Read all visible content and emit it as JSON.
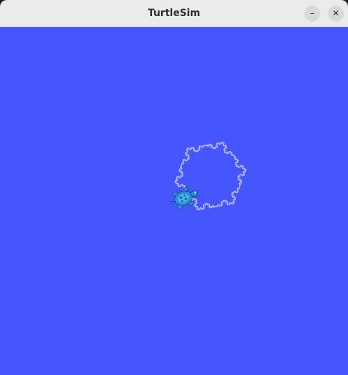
{
  "window": {
    "title": "TurtleSim"
  },
  "titlebar": {
    "minimize_glyph": "–",
    "close_glyph": "✕"
  },
  "canvas": {
    "background_color": "#4556ff",
    "pen_color": "#b3b8ff",
    "turtle_color": "#2a8fd6"
  }
}
